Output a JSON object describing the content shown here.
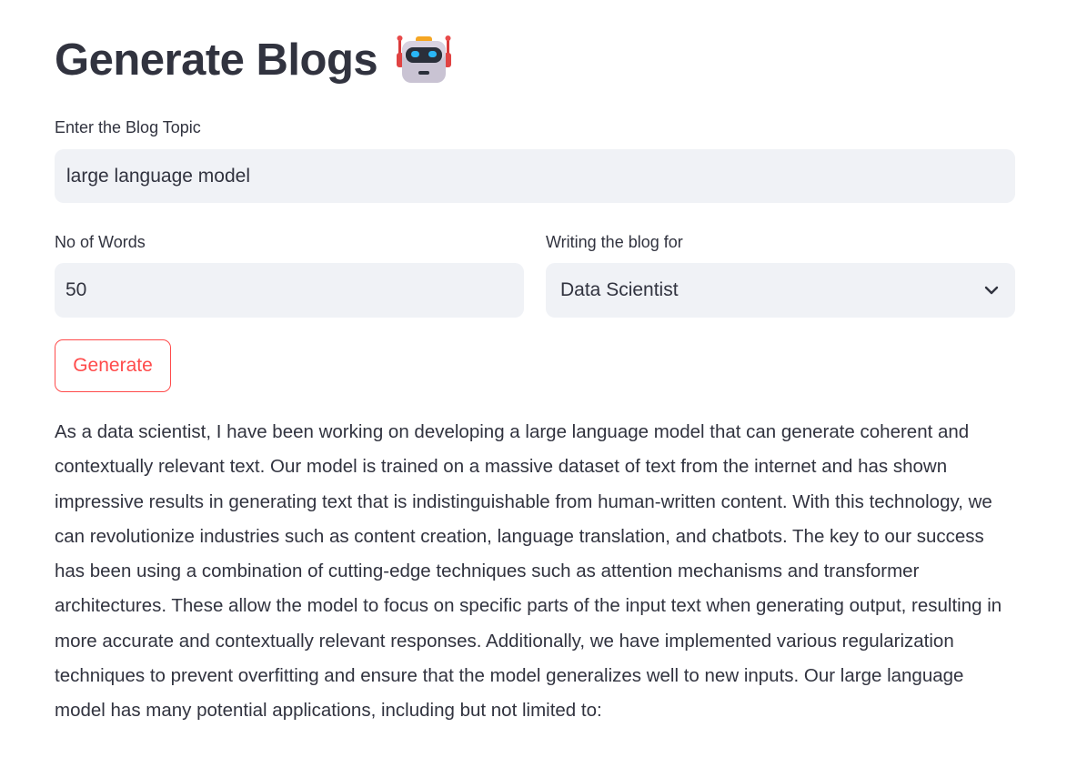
{
  "header": {
    "title": "Generate Blogs",
    "title_icon": "robot-face-icon"
  },
  "topic": {
    "label": "Enter the Blog Topic",
    "value": "large language model"
  },
  "words": {
    "label": "No of Words",
    "value": "50"
  },
  "audience": {
    "label": "Writing the blog for",
    "selected": "Data Scientist",
    "icon": "chevron-down-icon"
  },
  "actions": {
    "generate_label": "Generate"
  },
  "output": {
    "text": "As a data scientist, I have been working on developing a large language model that can generate coherent and contextually relevant text. Our model is trained on a massive dataset of text from the internet and has shown impressive results in generating text that is indistinguishable from human-written content. With this technology, we can revolutionize industries such as content creation, language translation, and chatbots. The key to our success has been using a combination of cutting-edge techniques such as attention mechanisms and transformer architectures. These allow the model to focus on specific parts of the input text when generating output, resulting in more accurate and contextually relevant responses. Additionally, we have implemented various regularization techniques to prevent overfitting and ensure that the model generalizes well to new inputs. Our large language model has many potential applications, including but not limited to:"
  },
  "colors": {
    "primary": "#FF4B4B",
    "text": "#31333F",
    "input_bg": "#F0F2F6"
  }
}
